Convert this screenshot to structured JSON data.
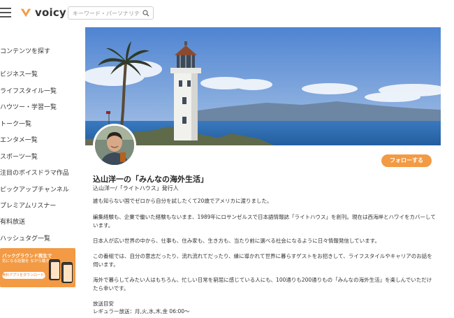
{
  "header": {
    "logo_text": "voicy",
    "search_placeholder": "キーワード・パーソナリテ",
    "icons": [
      "menu-icon",
      "voicy-logo-icon",
      "search-icon"
    ]
  },
  "sidebar": {
    "heading": "コンテンツを探す",
    "items": [
      {
        "label": "ビジネス一覧"
      },
      {
        "label": "ライフスタイル一覧"
      },
      {
        "label": "ハウツー・学習一覧"
      },
      {
        "label": "トーク一覧"
      },
      {
        "label": "エンタメ一覧"
      },
      {
        "label": "スポーツ一覧"
      },
      {
        "label": "注目のボイスドラマ作品"
      },
      {
        "label": "ピックアップチャンネル"
      },
      {
        "label": "プレミアムリスナー"
      },
      {
        "label": "有料放送"
      },
      {
        "label": "ハッシュタグ一覧"
      }
    ],
    "banner": {
      "line1": "バックグラウンド再生で",
      "line2": "気になる話題を ながら聴き",
      "button": "無料アプリをダウンロード！"
    }
  },
  "channel": {
    "title": "込山洋一の「みんなの海外生活」",
    "subtitle": "込山洋一/「ライトハウス」発行人",
    "follow_label": "フォローする",
    "description": [
      "誰も知らない国でゼロから自分を試したくて20歳でアメリカに渡りました。",
      "編集経験も、企業で働いた経験もないまま、1989年にロサンゼルスで日本語情報誌「ライトハウス」を創刊。現在は西海岸とハワイをカバーしています。",
      "日本人が広い世界の中から、仕事も、住み家も、生き方も、当たり前に選べる社会になるように日々情報発信しています。",
      "この番組では、自分の意志だったり、流れ流れてだったり、縁に導かれて世界に暮らすゲストをお招きして、ライフスタイルやキャリアのお話を伺います。",
      "海外で暮らしてみたい人はもちろん、忙しい日常を窮屈に感じている人にも、100通りも200通りもの「みんなの海外生活」を楽しんでいただけたら幸いです。",
      "放送目安",
      "レギュラー放送：月,火,水,木,金 06:00〜"
    ]
  },
  "colors": {
    "accent": "#f39a44",
    "sky": "#5b8fd6",
    "sea": "#2f6fb4"
  }
}
